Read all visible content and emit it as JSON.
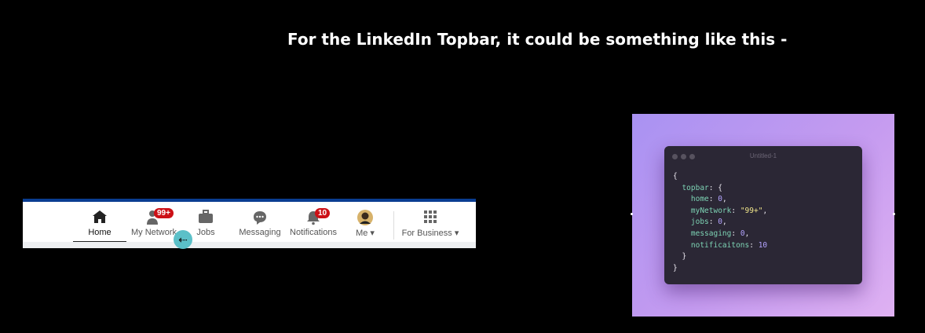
{
  "heading": "For the LinkedIn Topbar, it could be something like this -",
  "topbar": {
    "items": [
      {
        "label": "Home",
        "icon": "home-icon"
      },
      {
        "label": "My Network",
        "icon": "network-icon",
        "badge": "99+"
      },
      {
        "label": "Jobs",
        "icon": "briefcase-icon"
      },
      {
        "label": "Messaging",
        "icon": "messaging-icon"
      },
      {
        "label": "Notifications",
        "icon": "bell-icon",
        "badge": "10"
      },
      {
        "label": "Me",
        "icon": "avatar"
      },
      {
        "label": "For Business",
        "icon": "grid-icon"
      }
    ],
    "active_index": 0
  },
  "editor": {
    "title": "Untitled-1",
    "lines": {
      "l1": "{",
      "l2_key": "topbar",
      "home_key": "home",
      "home_val": "0",
      "network_key": "myNetwork",
      "network_val": "\"99+\"",
      "jobs_key": "jobs",
      "jobs_val": "0",
      "messaging_key": "messaging",
      "messaging_val": "0",
      "notif_key": "notificaitons",
      "notif_val": "10",
      "close_inner": "}",
      "close_outer": "}"
    }
  },
  "colors": {
    "linkedin_blue": "#0a3d91",
    "badge_red": "#cc1016",
    "gradient_start": "#a992f2",
    "gradient_end": "#dfb1f2"
  }
}
